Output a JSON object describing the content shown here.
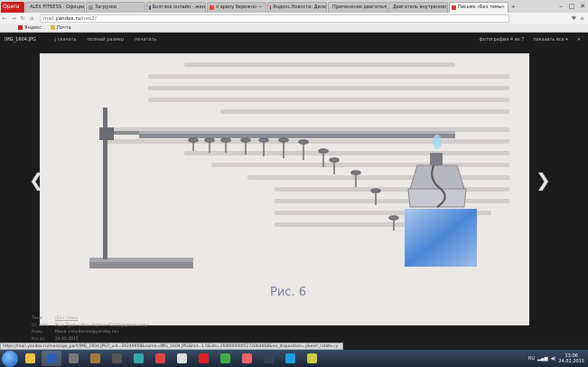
{
  "browser": {
    "opera_label": "Opera",
    "tabs": [
      {
        "label": "ALEX FITNESS - Официаль",
        "color": "#3a7bd5",
        "active": false
      },
      {
        "label": "Загрузки",
        "color": "#999999",
        "active": false
      },
      {
        "label": "Болтлок онлайн - жен",
        "color": "#3b5998",
        "active": false
      },
      {
        "label": "я арену бережно —",
        "color": "#e0492c",
        "active": false
      },
      {
        "label": "Яндекс.Новости: Деле",
        "color": "#d33",
        "active": false
      },
      {
        "label": "Применение двигателе",
        "color": "#c03",
        "active": false
      },
      {
        "label": "Двигатель внутреннего",
        "color": "#2a6",
        "active": false
      },
      {
        "label": "Письмо «Без темы»",
        "color": "#d33",
        "active": true
      }
    ],
    "address_prefix": "mail.",
    "address_domain": "yandex.ru",
    "address_rest": "/neo2/",
    "bookmarks": [
      "Яндекс",
      "Почта"
    ]
  },
  "viewer": {
    "filename": "IMG_1604.JPG",
    "actions": [
      "скачать",
      "полный размер",
      "печатать"
    ],
    "counter": "фотография 4 из 7",
    "show_all": "показать все ▾",
    "close": "✕",
    "figure_caption": "Рис. 6",
    "meta": [
      {
        "label": "Тема",
        "value": "(Без темы)",
        "link": true
      },
      {
        "label": "От кого",
        "value": "Яша Пухп <diva.shplace-93333@gmail.com>",
        "link": false
      },
      {
        "label": "Кому",
        "value": "Мила <shelterme@yandex.ru>",
        "link": false
      },
      {
        "label": "Когда",
        "value": "24.02.2015",
        "link": false
      }
    ]
  },
  "status_url": "https://mail.yandex.ru/message_part/IMG_1604.JPG?_uid=34249958&name=IMG_1604.JPG&hid=1.5&ids=2640000005272064668&no_disposition=y&exif_rotate=y",
  "taskbar": {
    "icons": [
      {
        "name": "explorer-icon",
        "color": "#f0c040"
      },
      {
        "name": "word-icon",
        "color": "#2b5fb4"
      },
      {
        "name": "game-cs-icon",
        "color": "#777"
      },
      {
        "name": "game-icon",
        "color": "#a47a3a"
      },
      {
        "name": "game-2-icon",
        "color": "#555"
      },
      {
        "name": "globe-icon",
        "color": "#3aa"
      },
      {
        "name": "paint-icon",
        "color": "#d44"
      },
      {
        "name": "files-icon",
        "color": "#ddd"
      },
      {
        "name": "opera-icon",
        "color": "#d22"
      },
      {
        "name": "chrome-icon",
        "color": "#4a4"
      },
      {
        "name": "player-icon",
        "color": "#e66"
      },
      {
        "name": "steam-icon",
        "color": "#345"
      },
      {
        "name": "skype-icon",
        "color": "#1a9ee0"
      },
      {
        "name": "notes-icon",
        "color": "#cc4"
      }
    ],
    "lang": "RU",
    "time": "13:06",
    "date": "24.02.2015"
  }
}
